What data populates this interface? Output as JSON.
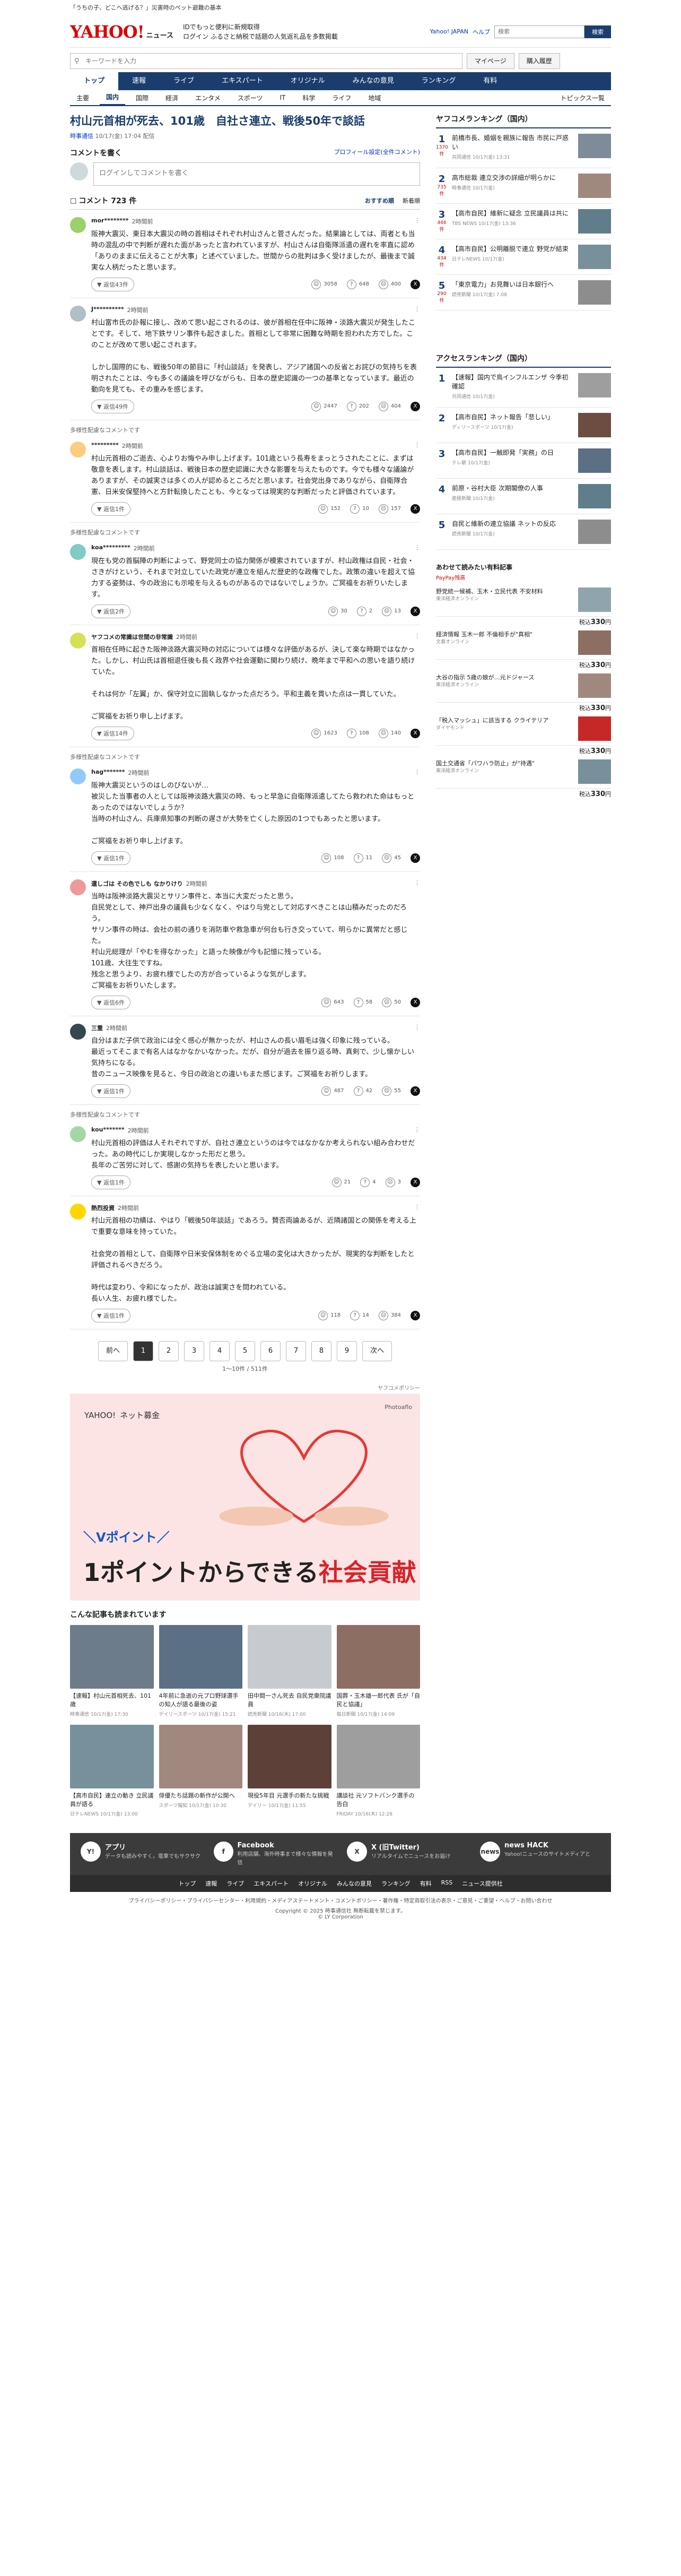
{
  "promo": {
    "text": "「うちの子、どこへ逃げる？」災害時のペット避難の基本",
    "link_label": ""
  },
  "header": {
    "logo": "YAHOO!",
    "logo_sub": "JAPAN",
    "section": "ニュース",
    "ad_line1": "IDでもっと便利に新規取得",
    "ad_line2": "ログイン ふるさと納税で話題の人気返礼品を多数掲載",
    "links": [
      "Yahoo! JAPAN",
      "ヘルプ"
    ],
    "search_placeholder": "検索",
    "search_button": "検索"
  },
  "toolbar": {
    "search_placeholder": "キーワードを入力",
    "mypage": "マイページ",
    "purchase": "購入履歴"
  },
  "nav": [
    "トップ",
    "速報",
    "ライブ",
    "エキスパート",
    "オリジナル",
    "みんなの意見",
    "ランキング",
    "有料"
  ],
  "subnav": [
    "主要",
    "国内",
    "国際",
    "経済",
    "エンタメ",
    "スポーツ",
    "IT",
    "科学",
    "ライフ",
    "地域"
  ],
  "subnav_right": "トピックス一覧",
  "article": {
    "title": "村山元首相が死去、101歳　自社さ連立、戦後50年で談話",
    "source": "時事通信",
    "date": "10/17(金) 17:04 配信"
  },
  "comment_form": {
    "heading": "コメントを書く",
    "policy": "プロフィール設定(全件コメント)",
    "placeholder": "ログインしてコメントを書く"
  },
  "comments_header": {
    "count": "コメント 723 件",
    "sort_recommended": "おすすめ順",
    "sort_new": "新着順"
  },
  "comments": [
    {
      "user": "mor********",
      "time": "2時間前",
      "text": "阪神大震災、東日本大震災の時の首相はそれぞれ村山さんと菅さんだった。結果論としては、両者とも当時の混乱の中で判断が遅れた面があったと言われていますが、村山さんは自衛隊派遣の遅れを率直に認め「ありのままに伝えることが大事」と述べていました。世間からの批判は多く受けましたが、最後まで誠実な人柄だったと思います。",
      "reply_label": "返信43件",
      "likes": "3058",
      "unsure": "648",
      "disagree": "400",
      "bg": "#9bd06a"
    },
    {
      "user": "J**********",
      "time": "2時間前",
      "text": "村山富市氏の訃報に接し、改めて思い起こされるのは、彼が首相在任中に阪神・淡路大震災が発生したことです。そして、地下鉄サリン事件も起きました。首相として非常に困難な時期を担われた方でした。このことが改めて思い起こされます。\n\nしかし国際的にも、戦後50年の節目に「村山談話」を発表し、アジア諸国への反省とお詫びの気持ちを表明されたことは、今も多くの議論を呼びながらも、日本の歴史認識の一つの基準となっています。最近の動向を見ても、その重みを感じます。",
      "reply_label": "返信49件",
      "likes": "2447",
      "unsure": "202",
      "disagree": "404",
      "bg": "#b0bec5"
    },
    {
      "pin": "多様性配慮なコメントです",
      "user": "*********",
      "time": "2時間前",
      "text": "村山元首相のご逝去、心よりお悔やみ申し上げます。101歳という長寿をまっとうされたことに、まずは敬意を表します。村山談話は、戦後日本の歴史認識に大きな影響を与えたものです。今でも様々な議論がありますが、その誠実さは多くの人が認めるところだと思います。社会党出身でありながら、自衛隊合憲、日米安保堅持へと方針転換したことも、今となっては現実的な判断だったと評価されています。",
      "reply_label": "返信1件",
      "likes": "152",
      "unsure": "10",
      "disagree": "157",
      "bg": "#ffcc80"
    },
    {
      "pin": "多様性配慮なコメントです",
      "user": "koa*********",
      "time": "2時間前",
      "text": "現在も党の首脳陣の判断によって、野党同士の協力関係が模索されていますが、村山政権は自民・社会・さきがけという、それまで対立していた政党が連立を組んだ歴史的な政権でした。政策の違いを超えて協力する姿勢は、今の政治にも示唆を与えるものがあるのではないでしょうか。ご冥福をお祈りいたします。",
      "reply_label": "返信2件",
      "likes": "30",
      "unsure": "2",
      "disagree": "13",
      "bg": "#80cbc4"
    },
    {
      "user": "ヤフコメの常識は世間の非常識",
      "time": "2時間前",
      "text": "首相在任時に起きた阪神淡路大震災時の対応については様々な評価があるが、決して楽な時期ではなかった。しかし、村山氏は首相退任後も長く政界や社会運動に関わり続け、晩年まで平和への思いを語り続けていた。\n\nそれは何か「左翼」か、保守対立に固執しなかった点だろう。平和主義を貫いた点は一貫していた。\n\nご冥福をお祈り申し上げます。",
      "reply_label": "返信14件",
      "likes": "1623",
      "unsure": "108",
      "disagree": "140",
      "bg": "#d4e157"
    },
    {
      "pin": "多様性配慮なコメントです",
      "user": "hag*******",
      "time": "2時間前",
      "text": "阪神大震災というのはしのびないが…\n被災した当事者の人としては阪神淡路大震災の時、もっと早急に自衛隊派遣してたら救われた命はもっとあったのではないでしょうか？\n当時の村山さん、兵庫県知事の判断の遅さが大勢を亡くした原因の1つでもあったと思います。\n\nご冥福をお祈り申し上げます。",
      "reply_label": "返信1件",
      "likes": "108",
      "unsure": "11",
      "disagree": "45",
      "bg": "#90caf9"
    },
    {
      "user": "還しゴは その色でしも なかりけり",
      "time": "2時間前",
      "text": "当時は阪神淡路大震災とサリン事件と、本当に大変だったと思う。\n自民党として、神戸出身の議員も少なくなく、やはり与党として対応すべきことは山積みだったのだろう。\nサリン事件の時は、会社の前の通りを消防車や救急車が何台も行き交っていて、明らかに異常だと感じた。\n村山元総理が「やむを得なかった」と語った映像が今も記憶に残っている。\n101歳、大往生ですね。\n残念と思うより、お疲れ様でしたの方が合っているような気がします。\nご冥福をお祈りいたします。",
      "reply_label": "返信6件",
      "likes": "643",
      "unsure": "58",
      "disagree": "50",
      "bg": "#ef9a9a"
    },
    {
      "user": "三重",
      "time": "2時間前",
      "text": "自分はまだ子供で政治には全く感心が無かったが、村山さんの長い眉毛は強く印象に残っている。\n最近ってそこまで有名人はなかなかいなかった。だが、自分が過去を振り返る時、真剣で、少し懐かしい気持ちになる。\n昔のニュース映像を見ると、今日の政治との違いもまた感じます。ご冥福をお祈りします。",
      "reply_label": "返信1件",
      "likes": "487",
      "unsure": "42",
      "disagree": "55",
      "bg": "#37474f"
    },
    {
      "pin": "多様性配慮なコメントです",
      "user": "kou*******",
      "time": "2時間前",
      "text": "村山元首相の評価は人それぞれですが、自社さ連立というのは今ではなかなか考えられない組み合わせだった。あの時代にしか実現しなかった形だと思う。\n長年のご苦労に対して、感謝の気持ちを表したいと思います。",
      "reply_label": "返信1件",
      "likes": "21",
      "unsure": "4",
      "disagree": "3",
      "bg": "#a5d6a7"
    },
    {
      "user": "熱烈投資",
      "time": "2時間前",
      "text": "村山元首相の功績は、やはり「戦後50年談話」であろう。賛否両論あるが、近隣諸国との関係を考える上で重要な意味を持っていた。\n\n社会党の首相として、自衛隊や日米安保体制をめぐる立場の変化は大きかったが、現実的な判断をしたと評価されるべきだろう。\n\n時代は変わり、令和になったが、政治は誠実さを問われている。\n長い人生、お疲れ様でした。",
      "reply_label": "返信1件",
      "likes": "118",
      "unsure": "14",
      "disagree": "384",
      "bg": "#ffd600"
    }
  ],
  "pager": {
    "prev": "前へ",
    "next": "次へ",
    "pages": [
      "1",
      "2",
      "3",
      "4",
      "5",
      "6",
      "7",
      "8",
      "9"
    ],
    "current": "1",
    "count": "1〜10件 / 511件"
  },
  "ad": {
    "sponsor": "ヤフコメポリシー",
    "brand": "YAHOO!",
    "brand_sub": "ネット募金",
    "tag": "Photoaflo",
    "line1": "＼Vポイント／",
    "line2_a": "1ポイントからできる",
    "line2_b": "社会貢献"
  },
  "also_read": {
    "heading": "こんな記事も読まれています",
    "cards": [
      {
        "title": "【速報】村山元首相死去、101歳",
        "src": "時事通信 10/17(金) 17:30",
        "bg": "#6d7c8a"
      },
      {
        "title": "4年前に急逝の元プロ野球選手の知人が語る最後の姿",
        "src": "デイリースポーツ 10/17(金) 15:21",
        "bg": "#5b6f85"
      },
      {
        "title": "田中間一さん死去 自民党衆院議員",
        "src": "読売新聞 10/16(木) 17:00",
        "bg": "#c7cbd0"
      },
      {
        "title": "国葬・玉木雄一郎代表 氏が「自民と協議」",
        "src": "毎日新聞 10/17(金) 14:09",
        "bg": "#8d6e63"
      },
      {
        "title": "【高市自民】連立の動き 立民議員が語る",
        "src": "日テレNEWS 10/17(金) 13:00",
        "bg": "#78909c"
      },
      {
        "title": "俳優たち話題の新作が公開へ",
        "src": "スポーツ報知 10/17(金) 10:30",
        "bg": "#a1887f"
      },
      {
        "title": "現役5年目 元選手の新たな挑戦",
        "src": "デイリー 10/17(金) 11:55",
        "bg": "#5d4037"
      },
      {
        "title": "講談社 元ソフトバンク選手の告白",
        "src": "FRIDAY 10/16(木) 12:28",
        "bg": "#9e9e9e"
      }
    ]
  },
  "ranking": {
    "heading": "ヤフコメランキング（国内）",
    "items": [
      {
        "no": "1",
        "cc": "1370件",
        "title": "前橋市長、婚姻を親族に報告 市民に戸惑い",
        "src": "共同通信 10/17(金) 13:31",
        "bg": "#7e8b99"
      },
      {
        "no": "2",
        "cc": "735件",
        "title": "高市総裁 連立交渉の詳細が明らかに",
        "src": "時事通信 10/17(金)",
        "bg": "#a1887f"
      },
      {
        "no": "3",
        "cc": "446件",
        "title": "【高市自民】維新に疑念 立民議員は共に",
        "src": "TBS NEWS 10/17(金) 13:36",
        "bg": "#607d8b"
      },
      {
        "no": "4",
        "cc": "434件",
        "title": "【高市自民】公明離脱で連立 野党が結束",
        "src": "日テレNEWS 10/17(金)",
        "bg": "#78909c"
      },
      {
        "no": "5",
        "cc": "290件",
        "title": "「東京電力」お見舞いは日本銀行へ",
        "src": "読売新聞 10/17(金) 7:08",
        "bg": "#8d8d8d"
      }
    ]
  },
  "access": {
    "heading": "アクセスランキング（国内）",
    "items": [
      {
        "no": "1",
        "title": "【速報】国内で鳥インフルエンザ 今季初確認",
        "src": "共同通信 10/17(金)",
        "bg": "#9e9e9e"
      },
      {
        "no": "2",
        "title": "【高市自民】ネット報告「悲しい」",
        "src": "ディリースポーツ 10/17(金)",
        "bg": "#6d4c41"
      },
      {
        "no": "3",
        "title": "【高市自民】一触即発「実務」の日",
        "src": "テレ朝 10/17(金)",
        "bg": "#5b6f85"
      },
      {
        "no": "4",
        "title": "前原・谷村大臣 次期閣僚の人事",
        "src": "産経新聞 10/17(金)",
        "bg": "#607d8b"
      },
      {
        "no": "5",
        "title": "自民と維新の連立協議 ネットの反応",
        "src": "読売新聞 10/17(金)",
        "bg": "#8d8d8d"
      }
    ]
  },
  "shopping": {
    "heading": "あわせて読みたい有料記事",
    "sub": "PayPay残高",
    "items": [
      {
        "title": "野党統一候補、玉木・立民代表 不安材料",
        "src": "東洋経済オンライン",
        "price": "330",
        "bg": "#90a4ae"
      },
      {
        "title": "経済情報 玉木一郎 不倫相手が\"真相\"",
        "src": "文春オンライン",
        "price": "330",
        "bg": "#8d6e63"
      },
      {
        "title": "大谷の指示 5歳の娘が…元ドジャース",
        "src": "東洋経済オンライン",
        "price": "330",
        "bg": "#a1887f"
      },
      {
        "title": "「税入マッシュ」に該当する クライテリア",
        "src": "ダイヤモンド",
        "price": "330",
        "bg": "#c62828"
      },
      {
        "title": "国土交通省「パワハラ防止」が\"待遇\"",
        "src": "東洋経済オンライン",
        "price": "330",
        "bg": "#78909c"
      }
    ]
  },
  "footer": {
    "apps": [
      {
        "name": "アプリ",
        "desc": "データも読みやすく。電車でもサクサク",
        "icon": "Y!"
      },
      {
        "name": "Facebook",
        "desc": "利用店舗、海外時事まで様々な情報を発信",
        "icon": "f"
      },
      {
        "name": "X (旧Twitter)",
        "desc": "リアルタイムでニュースをお届け",
        "icon": "X"
      },
      {
        "name": "news HACK",
        "desc": "Yahoo!ニュースのサイトメディアと",
        "icon": "news"
      }
    ],
    "nav": [
      "トップ",
      "速報",
      "ライブ",
      "エキスパート",
      "オリジナル",
      "みんなの意見",
      "ランキング",
      "有料",
      "RSS",
      "ニュース提供社"
    ],
    "links": "プライバシーポリシー・プライバシーセンター・利用規約・メディアステートメント・コメントポリシー・著作権・特定商取引法の表示・ご意見・ご要望・ヘルプ・お問い合わせ",
    "copyright": "Copyright © 2025 時事通信社 無断転載を禁じます。",
    "corp": "© LY Corporation"
  },
  "colors": {
    "accent": "#1a3d6d",
    "logo": "#d00000",
    "pink_ad": "#fde4e4"
  }
}
